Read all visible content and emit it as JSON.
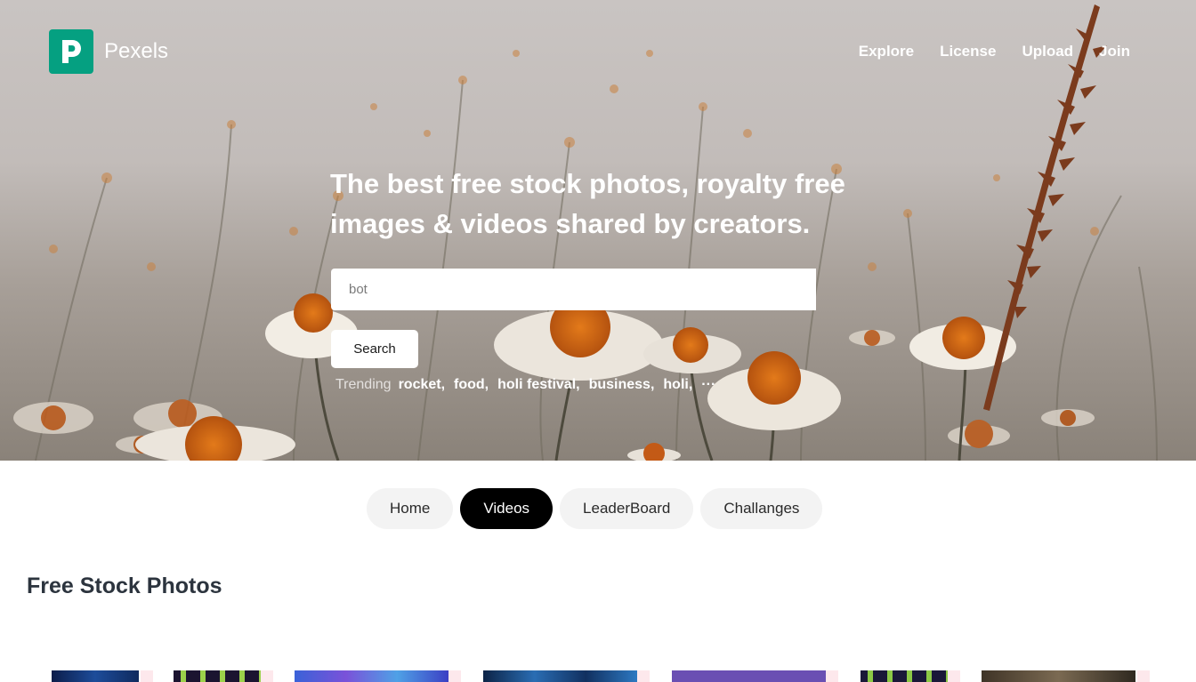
{
  "brand": {
    "name": "Pexels"
  },
  "nav": {
    "items": [
      "Explore",
      "License",
      "Upload",
      "Join"
    ]
  },
  "hero": {
    "headline": "The best free stock photos, royalty free images & videos shared by creators.",
    "search": {
      "value": "",
      "placeholder": "bot",
      "button_label": "Search"
    },
    "trending": {
      "label": "Trending",
      "items": [
        "rocket,",
        "food,",
        "holi festival,",
        "business,",
        "holi,"
      ],
      "more": "···"
    }
  },
  "tabs": [
    {
      "label": "Home",
      "active": false
    },
    {
      "label": "Videos",
      "active": true
    },
    {
      "label": "LeaderBoard",
      "active": false
    },
    {
      "label": "Challanges",
      "active": false
    }
  ],
  "section": {
    "title": "Free Stock Photos"
  },
  "colors": {
    "brand": "#05a081",
    "tab_active": "#000000",
    "tab_bg": "#f3f3f3",
    "heading": "#2c343e"
  },
  "icons": {
    "logo": "pexels-logo-icon",
    "more": "ellipsis-icon"
  }
}
